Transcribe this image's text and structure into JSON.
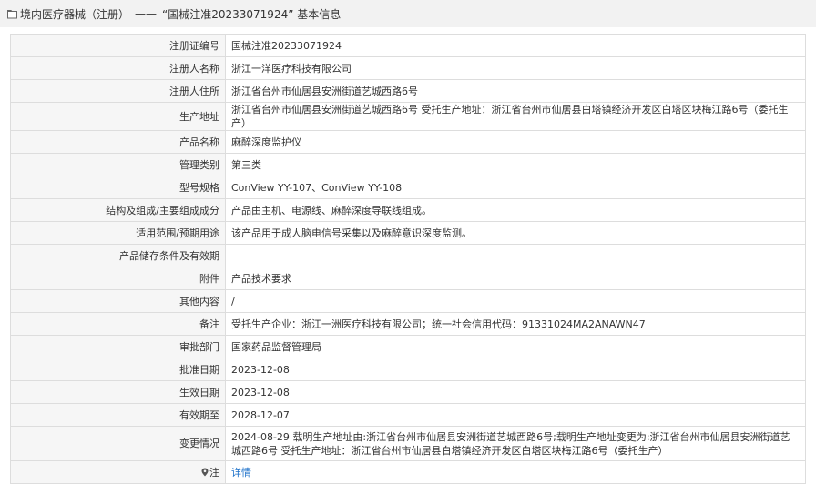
{
  "header": {
    "category": "境内医疗器械（注册）",
    "separator": "——",
    "title_suffix": "“国械注准20233071924” 基本信息"
  },
  "rows": [
    {
      "label": "注册证编号",
      "value": "国械注准20233071924"
    },
    {
      "label": "注册人名称",
      "value": "浙江一洋医疗科技有限公司"
    },
    {
      "label": "注册人住所",
      "value": "浙江省台州市仙居县安洲街道艺城西路6号"
    },
    {
      "label": "生产地址",
      "value": "浙江省台州市仙居县安洲街道艺城西路6号 受托生产地址：浙江省台州市仙居县白塔镇经济开发区白塔区块梅江路6号（委托生产）"
    },
    {
      "label": "产品名称",
      "value": "麻醉深度监护仪"
    },
    {
      "label": "管理类别",
      "value": "第三类"
    },
    {
      "label": "型号规格",
      "value": "ConView YY-107、ConView YY-108"
    },
    {
      "label": "结构及组成/主要组成成分",
      "value": "产品由主机、电源线、麻醉深度导联线组成。"
    },
    {
      "label": "适用范围/预期用途",
      "value": "该产品用于成人脑电信号采集以及麻醉意识深度监测。"
    },
    {
      "label": "产品储存条件及有效期",
      "value": ""
    },
    {
      "label": "附件",
      "value": "产品技术要求"
    },
    {
      "label": "其他内容",
      "value": "/"
    },
    {
      "label": "备注",
      "value": "受托生产企业：浙江一洲医疗科技有限公司；统一社会信用代码：91331024MA2ANAWN47"
    },
    {
      "label": "审批部门",
      "value": "国家药品监督管理局"
    },
    {
      "label": "批准日期",
      "value": "2023-12-08"
    },
    {
      "label": "生效日期",
      "value": "2023-12-08"
    },
    {
      "label": "有效期至",
      "value": "2028-12-07"
    },
    {
      "label": "变更情况",
      "value": "2024-08-29 载明生产地址由:浙江省台州市仙居县安洲街道艺城西路6号;载明生产地址变更为:浙江省台州市仙居县安洲街道艺城西路6号 受托生产地址：浙江省台州市仙居县白塔镇经济开发区白塔区块梅江路6号（委托生产）"
    }
  ],
  "note": {
    "label": "注",
    "link_text": "详情"
  },
  "colors": {
    "link": "#1a6fc9",
    "label_bg": "#f6f6f6",
    "border": "#dddddd",
    "header_bg": "#f2f2f2"
  }
}
